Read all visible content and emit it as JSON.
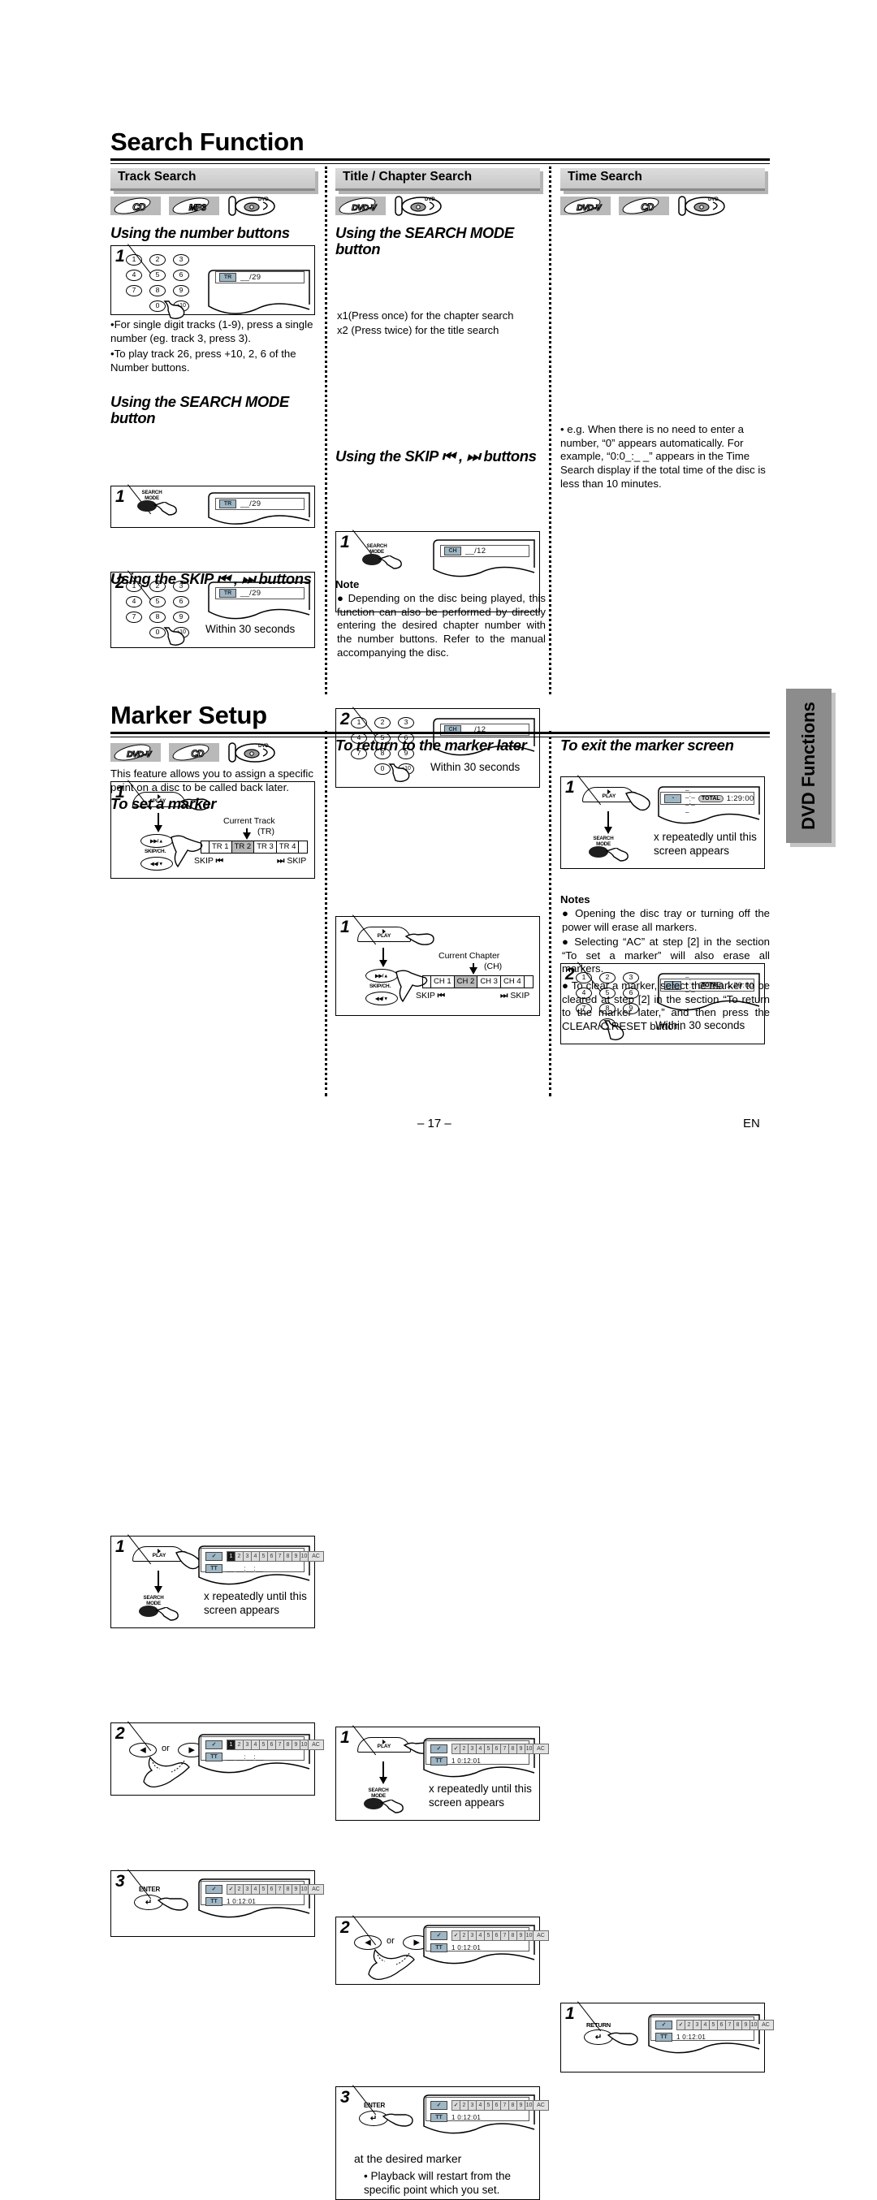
{
  "page": {
    "title": "Search Function",
    "title2": "Marker Setup",
    "side_tab": "DVD Functions",
    "page_number": "– 17 –",
    "language": "EN"
  },
  "sections": {
    "track_search": {
      "header": "Track Search",
      "discs": [
        "CD",
        "MP3",
        "DVD-disc"
      ],
      "sub1": "Using the number buttons",
      "step1_display": {
        "tag": "TR",
        "value": "__/29"
      },
      "bullets": [
        "•For single digit tracks (1-9), press a single number (eg. track 3, press 3).",
        "•To play track 26, press +10, 2, 6 of the Number buttons."
      ],
      "sub2": "Using the SEARCH MODE button",
      "step2_1_display": {
        "tag": "TR",
        "value": "__/29"
      },
      "step2_2_display": {
        "tag": "TR",
        "value": "__/29"
      },
      "step2_2_note": "Within 30 seconds",
      "sub3": "Using the SKIP ⏮ , ⏭ buttons",
      "strip_label": "Current Track",
      "strip_label2": "(TR)",
      "strip_cells": [
        "TR 1",
        "TR 2",
        "TR 3",
        "TR 4"
      ],
      "strip_current_index": 1,
      "skip_left": "SKIP",
      "skip_right": "SKIP",
      "play_label": "PLAY",
      "search_mode_label": "SEARCH MODE",
      "skipch_label": "SKIP/CH."
    },
    "title_chapter_search": {
      "header": "Title / Chapter Search",
      "discs": [
        "DVD-V",
        "DVD-disc"
      ],
      "sub1": "Using the SEARCH MODE button",
      "step1_display": {
        "tag": "CH",
        "value": "__/12"
      },
      "step1_notes": [
        "x1(Press once) for the chapter search",
        "x2 (Press twice) for the title search"
      ],
      "step2_display": {
        "tag": "CH",
        "value": "__/12"
      },
      "step2_note": "Within 30 seconds",
      "sub2": "Using the SKIP ⏮ , ⏭ buttons",
      "strip_label": "Current Chapter",
      "strip_label2": "(CH)",
      "strip_cells": [
        "CH 1",
        "CH 2",
        "CH 3",
        "CH 4"
      ],
      "strip_current_index": 1,
      "skip_left": "SKIP",
      "skip_right": "SKIP",
      "note_head": "Note",
      "note_body": "● Depending on the disc being played, this function can also be performed by directly entering the desired chapter number with the number buttons. Refer to the manual accompanying the disc."
    },
    "time_search": {
      "header": "Time Search",
      "discs": [
        "DVD-V",
        "CD",
        "DVD-disc"
      ],
      "step1_display": {
        "tag": "clock",
        "value": "_ _:_ _:_ _",
        "total_label": "TOTAL",
        "total_time": "1:29:00"
      },
      "step1_note": "x repeatedly until this screen appears",
      "step2_display": {
        "tag": "clock",
        "value": "_ _:_ _:_ _",
        "total_label": "TOTAL",
        "total_time": "1:29:00"
      },
      "step2_note": "Within 30 seconds",
      "bullet": "• e.g. When there is no need to enter a number, “0” appears automatically. For example, “0:0_:_ _” appears in the Time Search display if the total time of the disc is less than 10 minutes."
    },
    "marker_setup": {
      "discs": [
        "DVD-V",
        "CD",
        "DVD-disc"
      ],
      "intro": "This feature allows you to assign a specific point on a disc to be called back later.",
      "sub1": "To set a marker",
      "set_step1_note": "x repeatedly until this screen appears",
      "set_display": {
        "cells": [
          "1",
          "2",
          "3",
          "4",
          "5",
          "6",
          "7",
          "8",
          "9",
          "10",
          "AC"
        ],
        "selected": 0,
        "tag": "TT",
        "time": "__ __:__:__"
      },
      "set_display3": {
        "cells": [
          "✓",
          "2",
          "3",
          "4",
          "5",
          "6",
          "7",
          "8",
          "9",
          "10",
          "AC"
        ],
        "selected": 0,
        "tag": "TT",
        "time": "1  0:12:01"
      },
      "or_label": "or",
      "enter_label": "ENTER",
      "sub2": "To return to the marker later",
      "ret_step1_note": "x repeatedly until this screen appears",
      "ret_display": {
        "cells": [
          "✓",
          "2",
          "3",
          "4",
          "5",
          "6",
          "7",
          "8",
          "9",
          "10",
          "AC"
        ],
        "selected": 0,
        "tag": "TT",
        "time": "1  0:12:01"
      },
      "ret_step3_caption": "at the desired marker",
      "ret_step3_bullet": "•  Playback will restart from the specific point which you set.",
      "sub3": "To exit the marker screen",
      "return_label": "RETURN",
      "exit_display": {
        "cells": [
          "✓",
          "2",
          "3",
          "4",
          "5",
          "6",
          "7",
          "8",
          "9",
          "10",
          "AC"
        ],
        "selected": 0,
        "tag": "TT",
        "time": "1  0:12:01"
      },
      "notes_head": "Notes",
      "notes": [
        "● Opening the disc tray or turning off the power will erase all markers.",
        "● Selecting “AC” at step [2] in the section “To set a marker” will also erase all markers.",
        "● To clear a marker, select the marker to be cleared at step [2] in the section “To return to the marker later,”  and then press the CLEAR/C.RESET button."
      ]
    }
  },
  "keys": {
    "row1": [
      "1",
      "2",
      "3"
    ],
    "row2": [
      "4",
      "5",
      "6"
    ],
    "row3": [
      "7",
      "8",
      "9"
    ],
    "row4": [
      "0",
      "+10"
    ],
    "row4_zero_only": [
      "0"
    ]
  },
  "labels": {
    "play": "PLAY",
    "search_mode_l1": "SEARCH",
    "search_mode_l2": "MODE",
    "skip_ch": "SKIP/CH.",
    "enter": "ENTER",
    "return": "RETURN",
    "skip": "SKIP"
  }
}
